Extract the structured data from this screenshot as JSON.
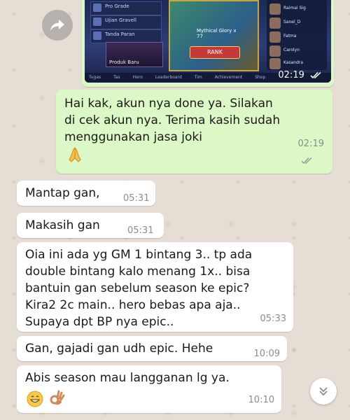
{
  "image_message": {
    "time": "02:19",
    "game_screenshot": {
      "rows": [
        "Pro Grade",
        "Ujian Gravell",
        "Tanda Paran"
      ],
      "hero_card_label": "Produk Baru",
      "badge_text": "Mythical Glory",
      "badge_stars": "x 77",
      "rank_button": "RANK",
      "friends": [
        "Raimai Sig",
        "Sanel_D",
        "Fatma",
        "Carolyn",
        "Kasandra"
      ],
      "bottom_tabs": [
        "Tugas",
        "Tas",
        "Hero",
        "Leaderboard",
        "Tim",
        "Achievement",
        "Shop"
      ]
    }
  },
  "messages": [
    {
      "text": "Hai kak, akun nya done ya. Silakan\ndi cek akun nya. Terima kasih sudah\nmenggunakan jasa joki",
      "emoji": "folded-hands",
      "time": "02:19",
      "direction": "outgoing",
      "status": "delivered"
    },
    {
      "text": "Mantap gan,",
      "time": "05:31",
      "direction": "incoming"
    },
    {
      "text": "Makasih gan",
      "time": "05:31",
      "direction": "incoming"
    },
    {
      "text": "Oia ini ada yg GM 1 bintang 3.. tp ada\ndouble bintang kalo menang 1x.. bisa\nbantuin gan sebelum season ke epic?\nKira2 2c main.. hero bebas apa aja..\nSupaya dpt BP nya epic..",
      "time": "05:33",
      "direction": "incoming"
    },
    {
      "text": "Gan, gajadi gan udh epic. Hehe",
      "time": "10:09",
      "direction": "incoming"
    },
    {
      "text": "Abis season mau langganan lg ya.",
      "emojis": [
        "grinning-face",
        "ok-hand"
      ],
      "time": "10:10",
      "direction": "incoming"
    }
  ],
  "colors": {
    "outgoing_bubble": "#dcf8c6",
    "incoming_bubble": "#ffffff",
    "wallpaper": "#e6ddd4",
    "timestamp": "#8c8c8c"
  }
}
